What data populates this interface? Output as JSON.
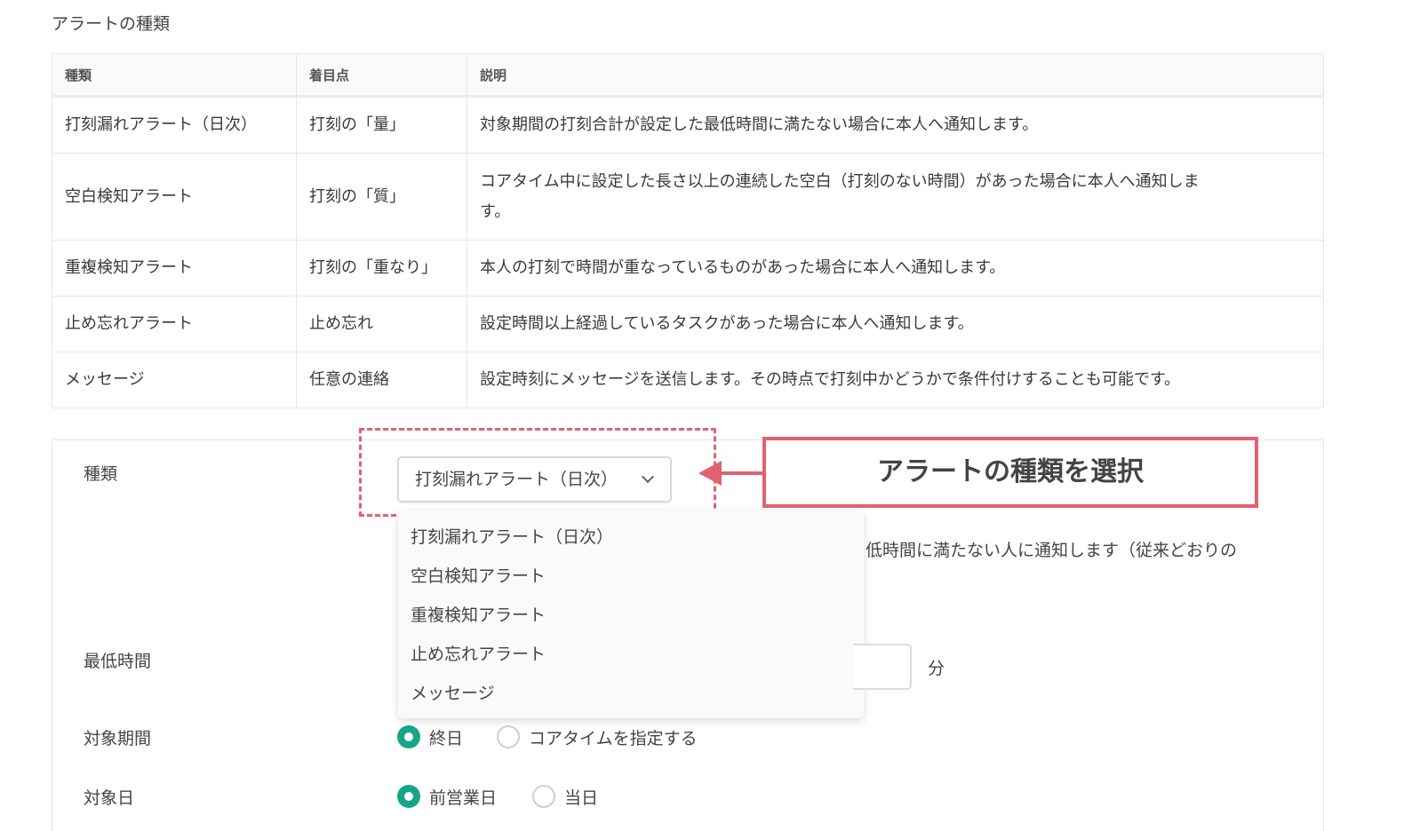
{
  "section_title": "アラートの種類",
  "table": {
    "headers": [
      "種類",
      "着目点",
      "説明"
    ],
    "rows": [
      {
        "type": "打刻漏れアラート（日次）",
        "focus": "打刻の「量」",
        "desc": "対象期間の打刻合計が設定した最低時間に満たない場合に本人へ通知します。"
      },
      {
        "type": "空白検知アラート",
        "focus": "打刻の「質」",
        "desc": "コアタイム中に設定した長さ以上の連続した空白（打刻のない時間）があった場合に本人へ通知しま",
        "desc_cont": "す。"
      },
      {
        "type": "重複検知アラート",
        "focus": "打刻の「重なり」",
        "desc": "本人の打刻で時間が重なっているものがあった場合に本人へ通知します。"
      },
      {
        "type": "止め忘れアラート",
        "focus": "止め忘れ",
        "desc": "設定時間以上経過しているタスクがあった場合に本人へ通知します。"
      },
      {
        "type": "メッセージ",
        "focus": "任意の連絡",
        "desc": "設定時刻にメッセージを送信します。その時点で打刻中かどうかで条件付けすることも可能です。"
      }
    ]
  },
  "form": {
    "type_label": "種類",
    "type_selected": "打刻漏れアラート（日次）",
    "type_options": [
      "打刻漏れアラート（日次）",
      "空白検知アラート",
      "重複検知アラート",
      "止め忘れアラート",
      "メッセージ"
    ],
    "description_partial": "低時間に満たない人に通知します（従来どおりの",
    "min_time_label": "最低時間",
    "min_time_unit": "分",
    "period_label": "対象期間",
    "period_options": [
      "終日",
      "コアタイムを指定する"
    ],
    "target_label_partial": "対象日",
    "target_options_partial": [
      "前営業日",
      "当日"
    ]
  },
  "callout": {
    "text": "アラートの種類を選択",
    "color": "#e0626e"
  },
  "accent_color": "#17a589"
}
